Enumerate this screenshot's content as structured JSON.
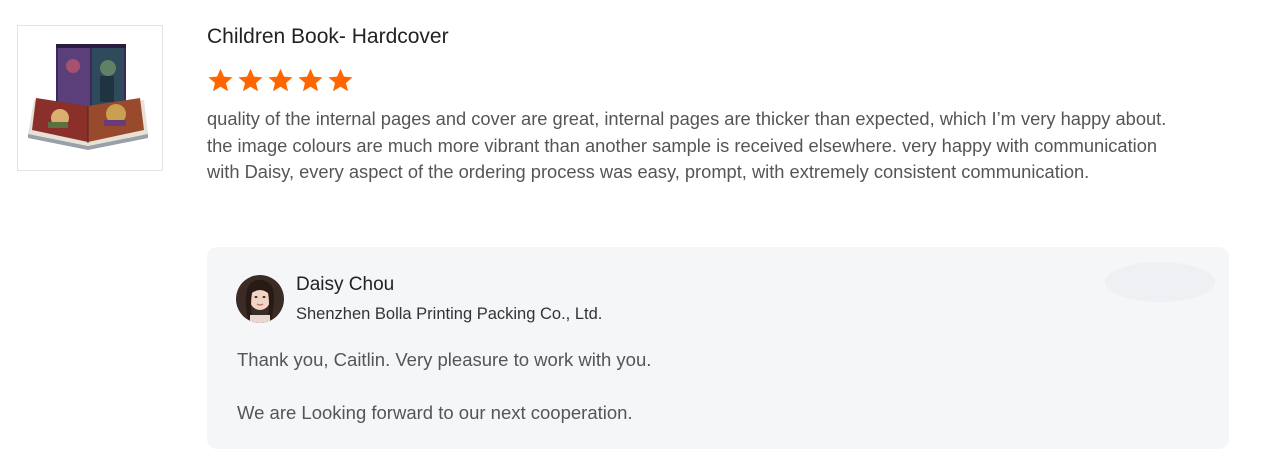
{
  "review": {
    "product_title": "Children Book- Hardcover",
    "rating": 5,
    "rating_max": 5,
    "star_color": "#ff6600",
    "text": "quality of the internal pages and cover are great, internal pages are thicker than expected, which I’m very happy about. the image colours are much more vibrant than another sample is received elsewhere. very happy with communication with Daisy, every aspect of the ordering process was easy, prompt, with extremely consistent communication."
  },
  "reply": {
    "name": "Daisy Chou",
    "company": "Shenzhen Bolla Printing Packing Co., Ltd.",
    "line1": "Thank you, Caitlin. Very pleasure to work with you.",
    "line2": "We are Looking forward to our next cooperation."
  }
}
